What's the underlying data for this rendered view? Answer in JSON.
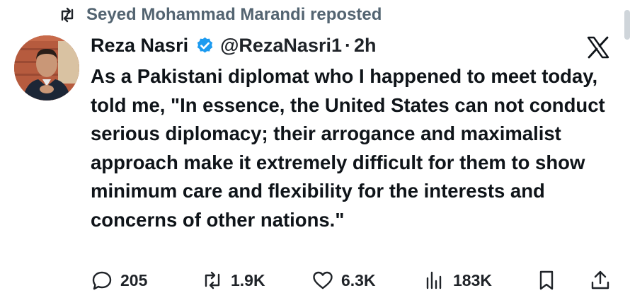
{
  "repost": {
    "text": "Seyed Mohammad Marandi reposted",
    "icon": "repost-icon"
  },
  "author": {
    "name": "Reza Nasri",
    "handle": "@RezaNasri1",
    "separator": "·",
    "time": "2h",
    "verified_color": "#1d9bf0"
  },
  "tweet": {
    "text": "As a Pakistani diplomat who I happened to meet today, told me, \"In essence, the United States can not conduct serious diplomacy; their arrogance and maximalist approach make it extremely difficult for them to show minimum care and flexibility for the interests and concerns of other nations.\""
  },
  "actions": {
    "replies": "205",
    "reposts": "1.9K",
    "likes": "6.3K",
    "views": "183K"
  },
  "brand": {
    "logo": "x-logo-icon"
  }
}
